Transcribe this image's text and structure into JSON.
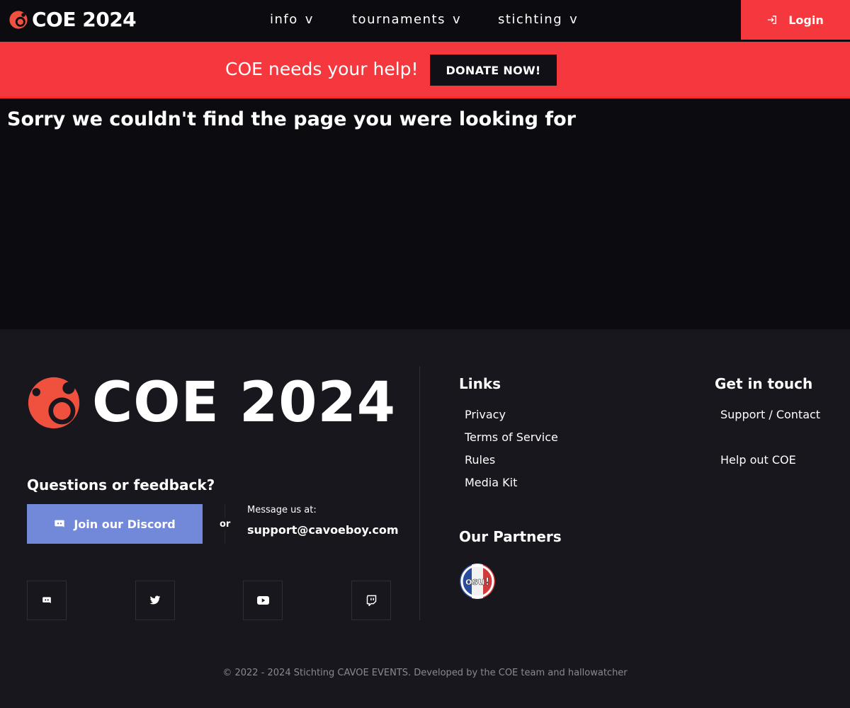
{
  "nav": {
    "brand": "COE 2024",
    "menus": [
      {
        "label": "info",
        "chevron": "v"
      },
      {
        "label": "tournaments",
        "chevron": "v"
      },
      {
        "label": "stichting",
        "chevron": "v"
      }
    ],
    "login_label": "Login",
    "accent_color": "#f5383e"
  },
  "banner": {
    "text": "COE needs your help!",
    "donate_label": "DONATE NOW!"
  },
  "main": {
    "headline": "Sorry we couldn't find the page you were looking for"
  },
  "footer": {
    "brand": "COE 2024",
    "questions_title": "Questions or feedback?",
    "discord_button": "Join our Discord",
    "or_text": "or",
    "message_label": "Message us at:",
    "email": "support@cavoeboy.com",
    "socials": [
      "discord-icon",
      "twitter-icon",
      "youtube-icon",
      "twitch-icon"
    ],
    "links_title": "Links",
    "links": [
      "Privacy",
      "Terms of Service",
      "Rules",
      "Media Kit"
    ],
    "partners_title": "Our Partners",
    "partner_logo_text": "osu!",
    "contact_title": "Get in touch",
    "contact_links": [
      "Support / Contact",
      "Help out COE"
    ],
    "copyright": "© 2022 - 2024 Stichting CAVOE EVENTS. Developed by the COE team and hallowatcher",
    "discord_color": "#7289da"
  }
}
